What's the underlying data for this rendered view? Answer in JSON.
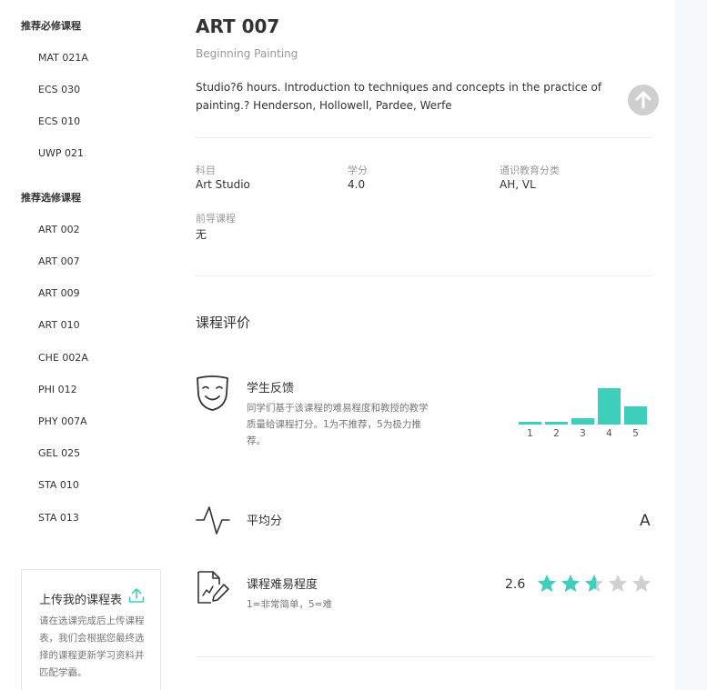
{
  "sidebar": {
    "required_heading": "推荐必修课程",
    "required": [
      "MAT 021A",
      "ECS 030",
      "ECS 010",
      "UWP 021"
    ],
    "elective_heading": "推荐选修课程",
    "electives": [
      "ART 002",
      "ART 007",
      "ART 009",
      "ART 010",
      "CHE 002A",
      "PHI 012",
      "PHY 007A",
      "GEL 025",
      "STA 010",
      "STA 013"
    ],
    "upload": {
      "title": "上传我的课程表",
      "icon": "upload-icon",
      "desc": "请在选课完成后上传课程表，我们会根据您最终选择的课程更新学习资料并匹配学霸。"
    }
  },
  "course": {
    "code": "ART 007",
    "name": "Beginning Painting",
    "desc": "Studio?6 hours. Introduction to techniques and concepts in the practice of painting.? Henderson, Hollowell, Pardee, Werfe",
    "info": {
      "subject_label": "科目",
      "subject": "Art Studio",
      "credits_label": "学分",
      "credits": "4.0",
      "ge_label": "通识教育分类",
      "ge": "AH, VL",
      "prereq_label": "前导课程",
      "prereq": "无"
    }
  },
  "reviews": {
    "title": "课程评价",
    "feedback": {
      "title": "学生反馈",
      "desc": "同学们基于该课程的难易程度和教授的教学质量给课程打分。1为不推荐，5为极力推荐。",
      "icon": "smile-mask-icon"
    },
    "histogram": {
      "labels": [
        "1",
        "2",
        "3",
        "4",
        "5"
      ],
      "values": [
        1,
        1,
        2,
        12,
        6
      ],
      "color": "#3ecfbc"
    },
    "average": {
      "title": "平均分",
      "grade": "A",
      "icon": "pulse-icon"
    },
    "difficulty": {
      "title": "课程难易程度",
      "desc": "1=非常简单，5=难",
      "score": "2.6",
      "rating": 2.6,
      "max": 5,
      "icon": "document-edit-icon"
    }
  },
  "colors": {
    "accent": "#3ecfbc",
    "star_empty": "#d0d0d0"
  },
  "scroll_top_icon": "arrow-up-icon"
}
